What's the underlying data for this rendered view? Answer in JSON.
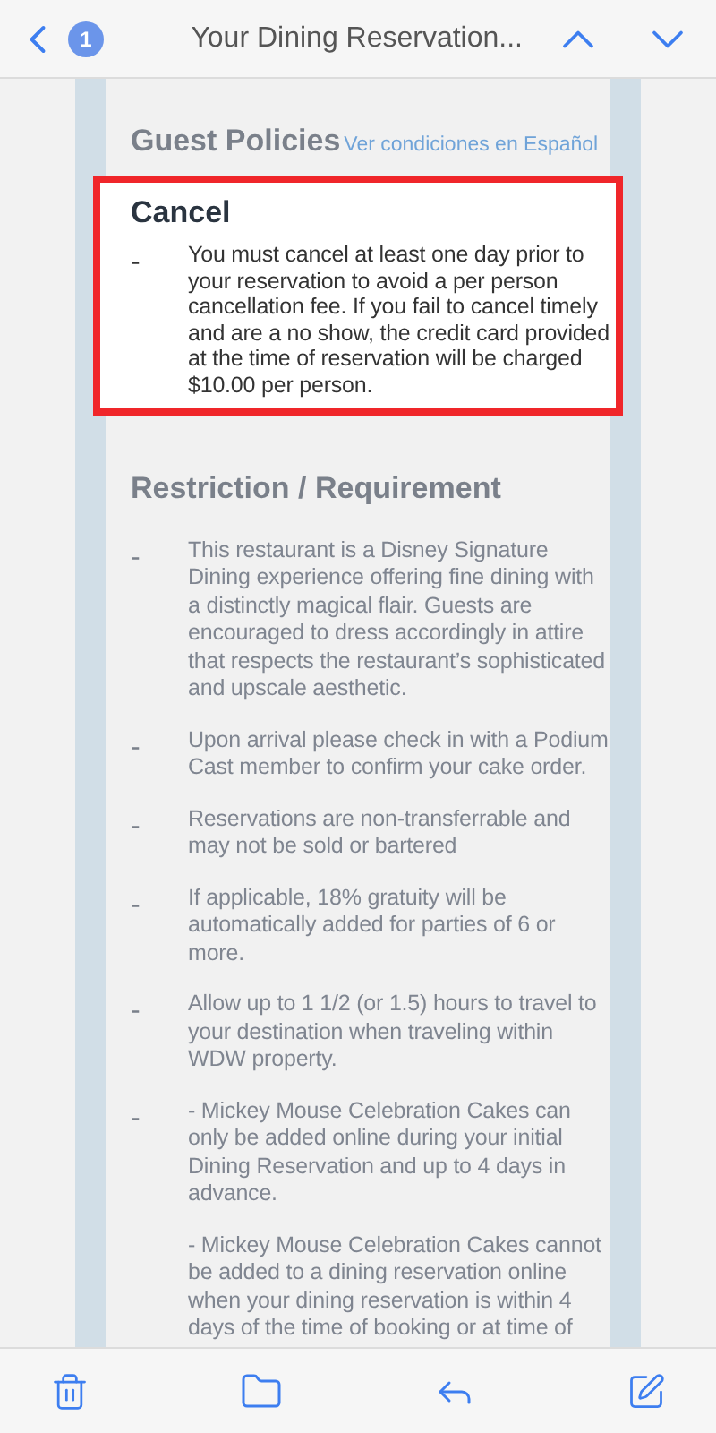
{
  "nav": {
    "badge": "1",
    "title": "Your Dining Reservation..."
  },
  "section_title": "Guest Policies",
  "spanish_link": "Ver condiciones en Español",
  "cancel": {
    "title": "Cancel",
    "highlighted": true,
    "items": [
      {
        "dash": "-",
        "text": "You must cancel at least one day prior to your reservation to avoid a per person cancellation fee. If you fail to cancel timely and are a no show, the credit card provided at the time of reservation will be charged $10.00 per person."
      }
    ]
  },
  "restriction": {
    "title": "Restriction / Requirement",
    "items": [
      {
        "dash": "-",
        "text": "This restaurant is a Disney Signature Dining experience offering fine dining with a distinctly magical flair. Guests are encouraged to dress accordingly in attire that respects the restaurant’s sophisticated and upscale aesthetic."
      },
      {
        "dash": "-",
        "text": "Upon arrival please check in with a Podium Cast member to confirm your cake order."
      },
      {
        "dash": "-",
        "text": "Reservations are non-transferrable and may not be sold or bartered"
      },
      {
        "dash": "-",
        "text": "If applicable, 18% gratuity will be automatically added for parties of 6 or more."
      },
      {
        "dash": "-",
        "text": "Allow up to 1 1/2 (or 1.5) hours to travel to your destination when traveling within WDW property."
      },
      {
        "dash": "-",
        "text": "- Mickey Mouse Celebration Cakes can only be added online during your initial Dining Reservation and up to 4 days in advance."
      },
      {
        "text": "- Mickey Mouse Celebration Cakes cannot be added to a dining reservation online when your dining reservation is within 4 days of the time of booking or at time of"
      }
    ]
  }
}
